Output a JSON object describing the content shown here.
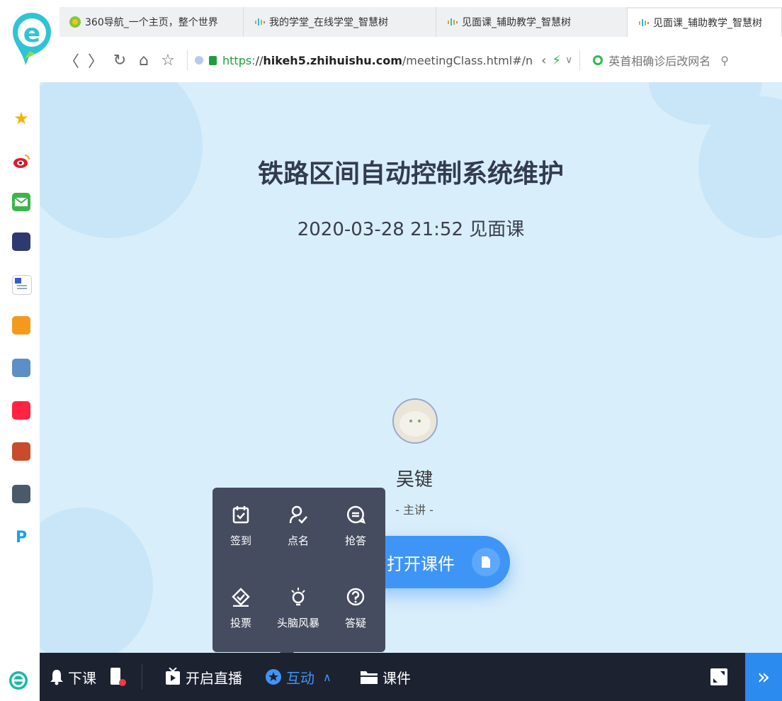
{
  "browser": {
    "tabs": [
      {
        "title": "360导航_一个主页，整个世界",
        "icon": "360-icon"
      },
      {
        "title": "我的学堂_在线学堂_智慧树",
        "icon": "zhihuishu-icon"
      },
      {
        "title": "见面课_辅助教学_智慧树",
        "icon": "zhihuishu-icon"
      },
      {
        "title": "见面课_辅助教学_智慧树",
        "icon": "zhihuishu-icon"
      }
    ],
    "url": {
      "scheme": "https:",
      "sep": "//",
      "domain": "hikeh5.zhihuishu.com",
      "path": "/meetingClass.html#/n"
    },
    "search_text": "英首相确诊后改网名"
  },
  "page": {
    "title": "铁路区间自动控制系统维护",
    "subtitle": "2020-03-28 21:52 见面课",
    "teacher_name": "吴键",
    "teacher_role": "- 主讲 -",
    "open_courseware_label": "打开课件"
  },
  "interaction_popup": {
    "items": [
      {
        "label": "签到",
        "icon": "checkin-icon"
      },
      {
        "label": "点名",
        "icon": "rollcall-icon"
      },
      {
        "label": "抢答",
        "icon": "quick-answer-icon"
      },
      {
        "label": "投票",
        "icon": "vote-icon"
      },
      {
        "label": "头脑风暴",
        "icon": "brainstorm-icon"
      },
      {
        "label": "答疑",
        "icon": "qa-icon"
      }
    ]
  },
  "toolbar": {
    "end_class": "下课",
    "live": "开启直播",
    "interact": "互动",
    "courseware": "课件",
    "expand_glyph": "»"
  },
  "colors": {
    "accent": "#3f95f6",
    "toolbar": "#1d2231",
    "popup": "#464c5f",
    "page_bg": "#d9eefb"
  }
}
